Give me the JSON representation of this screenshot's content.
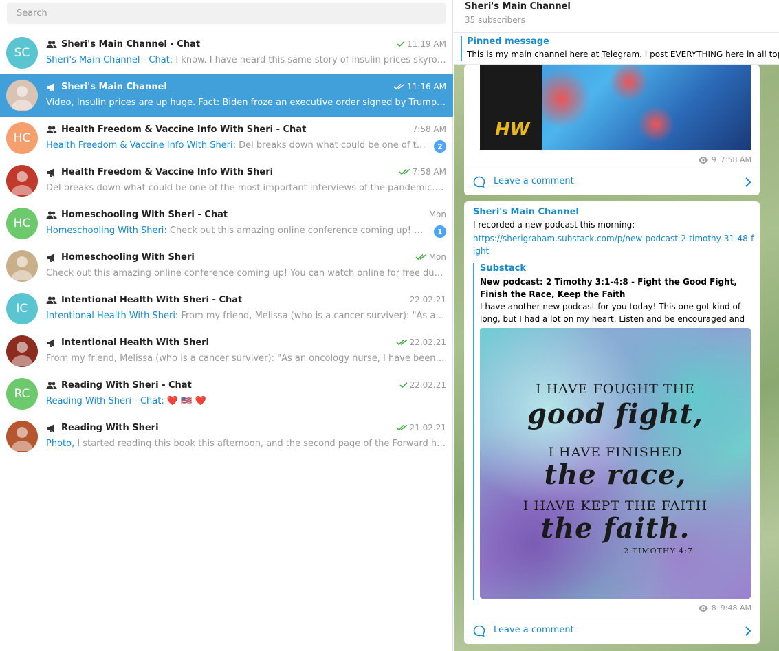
{
  "search": {
    "placeholder": "Search"
  },
  "chats": [
    {
      "title": "Sheri's Main Channel - Chat",
      "type": "group",
      "time": "11:19 AM",
      "check": "single",
      "sender": "Sheri's Main Channel - Chat:",
      "preview": " I know. I have heard this same story of insulin prices skyrocketing. Thanks for sharing",
      "avatar": "SC",
      "avatar_color": "#5bc4d1",
      "badge": ""
    },
    {
      "title": "Sheri's Main Channel",
      "type": "channel",
      "time": "11:16 AM",
      "check": "double",
      "sender": "",
      "preview": "Video, Insulin prices are up huge.   Fact: Biden froze an executive order signed by Trump that was meant to lower prices",
      "avatar": "",
      "avatar_color": "#d9c3b4",
      "badge": ""
    },
    {
      "title": "Health Freedom & Vaccine Info With Sheri - Chat",
      "type": "group",
      "time": "7:58 AM",
      "check": "",
      "sender": "Health Freedom & Vaccine Info With Sheri:",
      "preview": " Del breaks down what could be one of the most important interviews",
      "avatar": "HC",
      "avatar_color": "#f59f6e",
      "badge": "2"
    },
    {
      "title": "Health Freedom & Vaccine Info With Sheri",
      "type": "channel",
      "time": "7:58 AM",
      "check": "double",
      "sender": "",
      "preview": "Del breaks down what could be one of the most important interviews of the pandemic. https://thehighwire.com/videos",
      "avatar": "",
      "avatar_color": "#c0392b",
      "badge": ""
    },
    {
      "title": "Homeschooling With Sheri - Chat",
      "type": "group",
      "time": "Mon",
      "check": "",
      "sender": "Homeschooling With Sheri:",
      "preview": " Check out this amazing online conference coming up! You can watch online for free",
      "avatar": "HC",
      "avatar_color": "#6cc96c",
      "badge": "1"
    },
    {
      "title": "Homeschooling With Sheri",
      "type": "channel",
      "time": "Mon",
      "check": "double",
      "sender": "",
      "preview": "Check out this amazing online conference coming up! You can watch online for free during the conference",
      "avatar": "",
      "avatar_color": "#c9b08a",
      "badge": ""
    },
    {
      "title": "Intentional Health With Sheri - Chat",
      "type": "group",
      "time": "22.02.21",
      "check": "",
      "sender": "Intentional Health With Sheri:",
      "preview": " From my friend, Melissa (who is a cancer surviver):  \"As an oncology nurse, I have been",
      "avatar": "IC",
      "avatar_color": "#5bc4d1",
      "badge": ""
    },
    {
      "title": "Intentional Health With Sheri",
      "type": "channel",
      "time": "22.02.21",
      "check": "double",
      "sender": "",
      "preview": "From my friend, Melissa (who is a cancer surviver):  \"As an oncology nurse, I have been saying for years",
      "avatar": "",
      "avatar_color": "#8b2c1e",
      "badge": ""
    },
    {
      "title": "Reading With Sheri - Chat",
      "type": "group",
      "time": "22.02.21",
      "check": "single",
      "sender": "Reading With Sheri - Chat:",
      "preview": " ❤️ 🇺🇸 ❤️",
      "avatar": "RC",
      "avatar_color": "#6cc96c",
      "badge": ""
    },
    {
      "title": "Reading With Sheri",
      "type": "channel",
      "time": "21.02.21",
      "check": "double",
      "sender": "Photo,",
      "preview": " I started reading this book this afternoon, and the second page of the Forward had these words",
      "avatar": "",
      "avatar_color": "#b5562e",
      "badge": ""
    }
  ],
  "channel": {
    "title": "Sheri's Main Channel",
    "subscribers": "35 subscribers"
  },
  "pinned": {
    "label": "Pinned message",
    "text": "This is my main channel here at Telegram. I post EVERYTHING here in all topics"
  },
  "msg1": {
    "image_text": "HW",
    "views": "9",
    "time": "7:58 AM",
    "comment": "Leave a comment"
  },
  "msg2": {
    "channel": "Sheri's Main Channel",
    "text": "I recorded a new podcast this morning:",
    "link": "https://sherigraham.substack.com/p/new-podcast-2-timothy-31-48-fight",
    "preview_site": "Substack",
    "preview_title": "New podcast: 2 Timothy 3:1-4:8 - Fight the Good Fight, Finish the Race, Keep the Faith",
    "preview_desc": "I have another new podcast for you today! This one got kind of long, but I had a lot on my heart. Listen and be encouraged and ...",
    "quote": {
      "l1": "I HAVE FOUGHT THE",
      "l2": "good fight,",
      "l3": "I HAVE FINISHED",
      "l4": "the race,",
      "l5": "I HAVE KEPT THE FAITH",
      "l6": "the faith.",
      "ref": "2 TIMOTHY 4:7"
    },
    "views": "8",
    "time": "9:48 AM",
    "comment": "Leave a comment"
  },
  "colors": {
    "accent": "#419fd9",
    "link": "#168acd",
    "check": "#4fae4e"
  }
}
